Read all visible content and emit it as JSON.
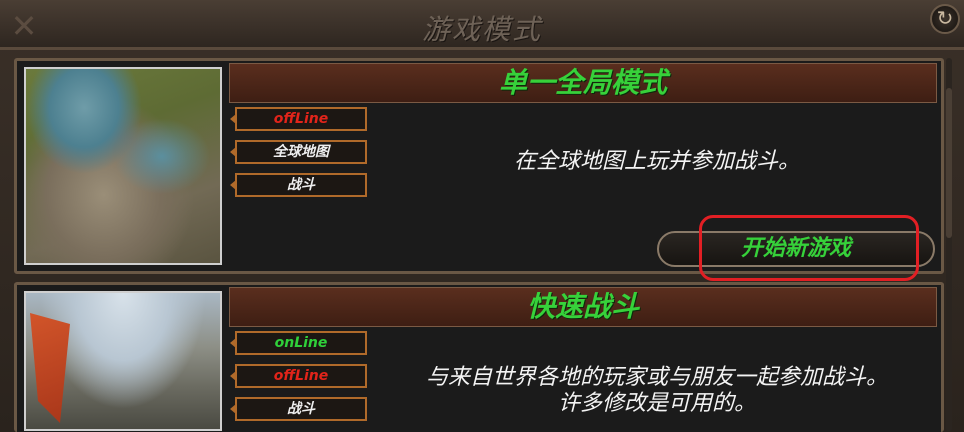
{
  "header": {
    "title": "游戏模式",
    "back_icon": "↻"
  },
  "modes": [
    {
      "heading": "单一全局模式",
      "tags": [
        "offLine",
        "全球地图",
        "战斗"
      ],
      "description": "在全球地图上玩并参加战斗。",
      "start_button": "开始新游戏"
    },
    {
      "heading": "快速战斗",
      "tags": [
        "onLine",
        "offLine",
        "战斗"
      ],
      "description_line1": "与来自世界各地的玩家或与朋友一起参加战斗。",
      "description_line2": "许多修改是可用的。"
    }
  ],
  "colors": {
    "accent_green": "#37d13a",
    "offline_red": "#e2241a",
    "highlight_red": "#e21f24"
  }
}
